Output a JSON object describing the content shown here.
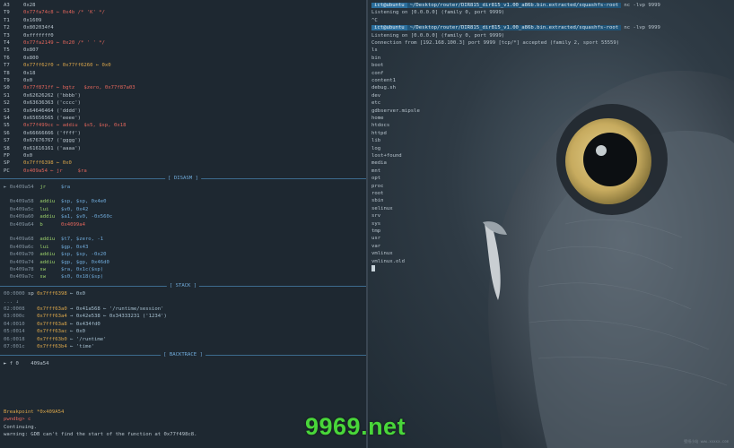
{
  "registers": [
    {
      "name": "A3",
      "value": "0x28",
      "style": ""
    },
    {
      "name": "T9",
      "value": "0x77fa74c8 ← 0x4b /* 'K' */",
      "style": "r"
    },
    {
      "name": "T1",
      "value": "0x1609",
      "style": ""
    },
    {
      "name": "T2",
      "value": "0x802034f4",
      "style": ""
    },
    {
      "name": "T3",
      "value": "0xfffffff0",
      "style": ""
    },
    {
      "name": "T4",
      "value": "0x77fa2149 ← 0x20 /* ' ' */",
      "style": "r"
    },
    {
      "name": "T5",
      "value": "0x807",
      "style": ""
    },
    {
      "name": "T6",
      "value": "0x800",
      "style": ""
    },
    {
      "name": "T7",
      "value": "0x77ff62f0 → 0x77ff6260 ← 0x0",
      "style": "y"
    },
    {
      "name": "T8",
      "value": "0x18",
      "style": ""
    },
    {
      "name": "T9",
      "value": "0x0",
      "style": ""
    },
    {
      "name": "S0",
      "value": "0x77f871ff ← bgtz   $zero, 0x77f87a03",
      "style": "r"
    },
    {
      "name": "S1",
      "value": "0x62626262 ('bbbb')",
      "style": ""
    },
    {
      "name": "S2",
      "value": "0x63636363 ('cccc')",
      "style": ""
    },
    {
      "name": "S3",
      "value": "0x64646464 ('dddd')",
      "style": ""
    },
    {
      "name": "S4",
      "value": "0x65656565 ('eeee')",
      "style": ""
    },
    {
      "name": "S5",
      "value": "0x77f499cc ← addiu  $s5, $sp, 0x18",
      "style": "r"
    },
    {
      "name": "S6",
      "value": "0x66666666 ('ffff')",
      "style": ""
    },
    {
      "name": "S7",
      "value": "0x67676767 ('gggg')",
      "style": ""
    },
    {
      "name": "S8",
      "value": "0x61616161 ('aaaa')",
      "style": ""
    },
    {
      "name": "FP",
      "value": "0x0",
      "style": ""
    },
    {
      "name": "SP",
      "value": "0x7fff6398 ← 0x0",
      "style": "y"
    },
    {
      "name": "PC",
      "value": "0x409a54 ← jr     $ra",
      "style": "r"
    }
  ],
  "sections": {
    "disasm": "DISASM",
    "stack": "STACK",
    "backtrace": "BACKTRACE"
  },
  "disasm": [
    {
      "addr": "► 0x409a54",
      "op": "jr",
      "args": "$ra"
    },
    {
      "addr": "",
      "op": "",
      "args": ""
    },
    {
      "addr": "  0x409a58",
      "op": "addiu",
      "args": "$sp, $sp, 0x4e0"
    },
    {
      "addr": "  0x409a5c",
      "op": "lui",
      "args": "$v0, 0x42"
    },
    {
      "addr": "  0x409a60",
      "op": "addiu",
      "args": "$a1, $v0, -0x560c"
    },
    {
      "addr": "  0x409a64",
      "op": "b",
      "args": "0x4099a4"
    },
    {
      "addr": "",
      "op": "",
      "args": ""
    },
    {
      "addr": "  0x409a68",
      "op": "addiu",
      "args": "$t7, $zero, -1"
    },
    {
      "addr": "  0x409a6c",
      "op": "lui",
      "args": "$gp, 0x43"
    },
    {
      "addr": "  0x409a70",
      "op": "addiu",
      "args": "$sp, $sp, -0x20"
    },
    {
      "addr": "  0x409a74",
      "op": "addiu",
      "args": "$gp, $gp, 0x46d0"
    },
    {
      "addr": "  0x409a78",
      "op": "sw",
      "args": "$ra, 0x1c($sp)"
    },
    {
      "addr": "  0x409a7c",
      "op": "sw",
      "args": "$s0, 0x18($sp)"
    }
  ],
  "stack": [
    {
      "idx": "00:0000",
      "reg": "sp",
      "text": "0x7fff6398 ← 0x0"
    },
    {
      "idx": "... ↓",
      "reg": "",
      "text": ""
    },
    {
      "idx": "02:0008",
      "reg": "",
      "text": "0x7fff63a0 → 0x41a568 ← '/runtime/session'"
    },
    {
      "idx": "03:000c",
      "reg": "",
      "text": "0x7fff63a4 → 0x42e538 ← 0x34333231 ('1234')"
    },
    {
      "idx": "04:0010",
      "reg": "",
      "text": "0x7fff63a8 ← 0x434fd0"
    },
    {
      "idx": "05:0014",
      "reg": "",
      "text": "0x7fff63ac ← 0x0"
    },
    {
      "idx": "06:0018",
      "reg": "",
      "text": "0x7fff63b0 ← '/runtime'"
    },
    {
      "idx": "07:001c",
      "reg": "",
      "text": "0x7fff63b4 ← 'time'"
    }
  ],
  "backtrace": [
    {
      "text": "► f 0    409a54"
    }
  ],
  "gdb_log": [
    {
      "text": "Breakpoint *0x409A54",
      "cls": "addr-y"
    },
    {
      "text": "pwndbg> c",
      "cls": "addr-r"
    },
    {
      "text": "Continuing.",
      "cls": ""
    },
    {
      "text": "warning: GDB can't find the start of the function at 0x77f498c8.",
      "cls": ""
    }
  ],
  "right_terminal": {
    "top_prompt_user": "ict@ubuntu",
    "top_prompt_path": "~/Desktop/router/DIR815_dir815_v1.00_a86b.bin.extracted/squashfs-root",
    "top_prompt_cmd": "nc -lvp 9999",
    "top_lines": [
      "Listening on [0.0.0.0] (family 0, port 9999)",
      "^C"
    ],
    "second_prompt_user": "ict@ubuntu",
    "second_prompt_path": "~/Desktop/router/DIR815_dir815_v1.00_a86b.bin.extracted/squashfs-root",
    "second_prompt_cmd": "nc -lvp 9999",
    "listen_line": "Listening on [0.0.0.0] (family 0, port 9999)",
    "conn_line": "Connection from [192.168.100.3] port 9999 [tcp/*] accepted (family 2, sport 55559)",
    "listing": [
      "ls",
      "bin",
      "boot",
      "conf",
      "content1",
      "debug.sh",
      "dev",
      "etc",
      "gdbserver.mipsle",
      "home",
      "htdocs",
      "httpd",
      "lib",
      "log",
      "lost+found",
      "media",
      "mnt",
      "opt",
      "proc",
      "root",
      "sbin",
      "selinux",
      "srv",
      "sys",
      "tmp",
      "usr",
      "var",
      "vmlinux",
      "vmlinux.old"
    ]
  },
  "watermark": "9969.net",
  "credit": "壁纸小站 www.xxxxx.com",
  "colors": {
    "accent": "#2b6e9c",
    "watermark": "#49d63a",
    "bg": "#1e2831"
  }
}
